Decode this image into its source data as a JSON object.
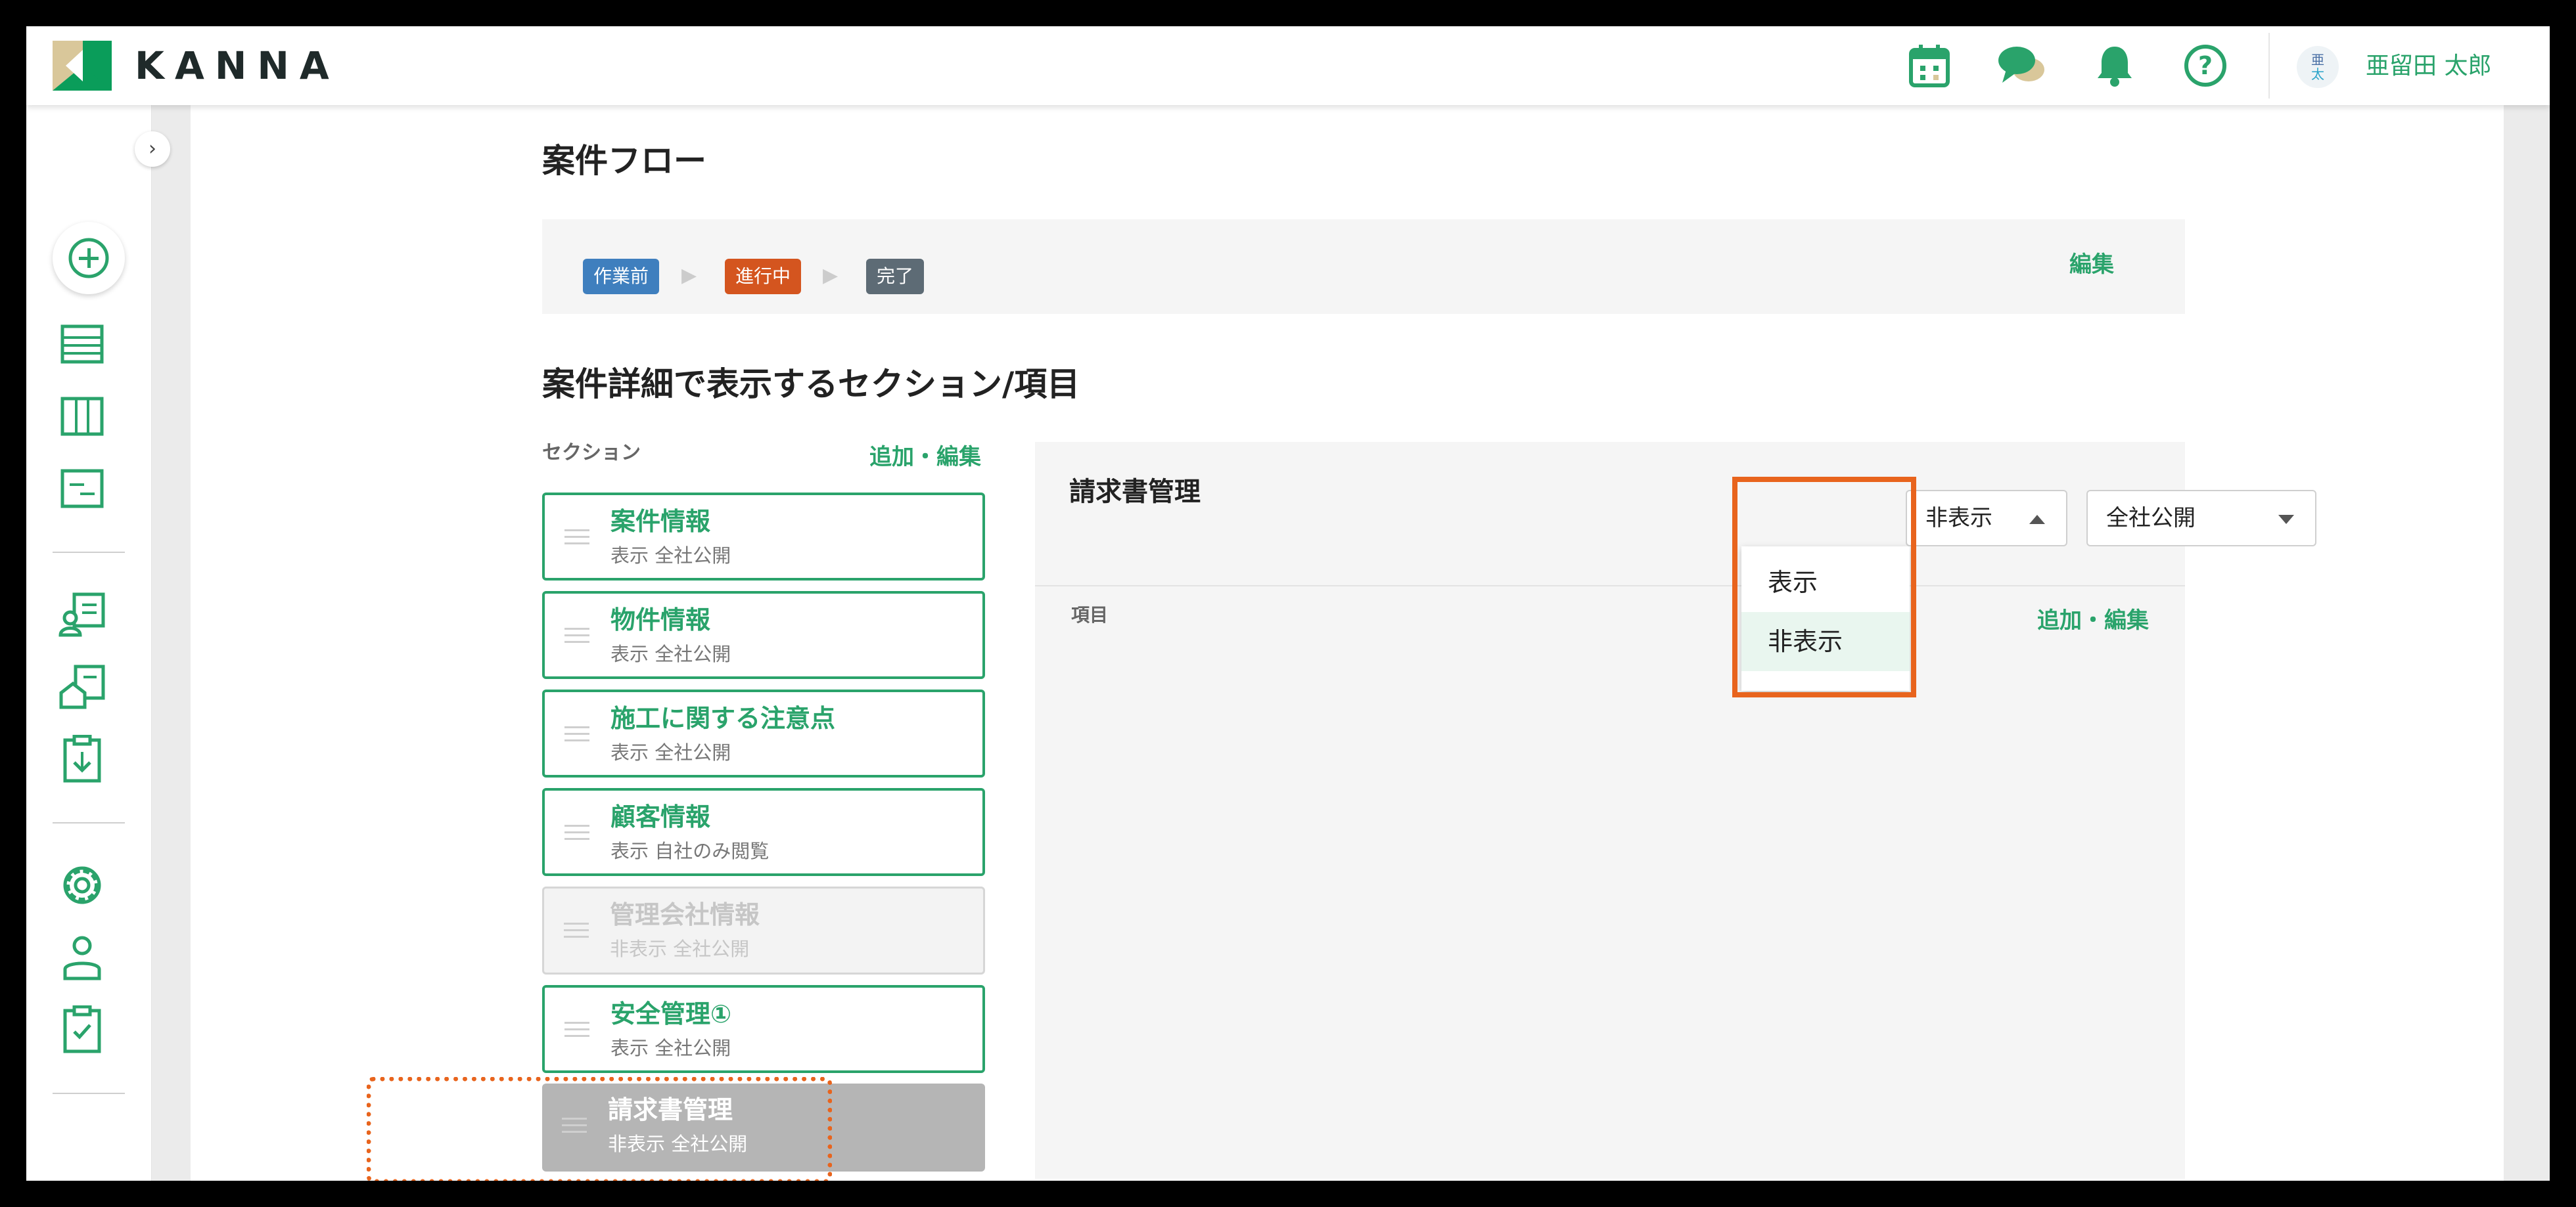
{
  "header": {
    "logo_text": "KANNA",
    "icons": [
      "calendar-icon",
      "chat-icon",
      "bell-icon",
      "help-icon"
    ],
    "avatar_line1": "亜",
    "avatar_line2": "太",
    "user_name": "亜留田 太郎"
  },
  "sidebar": {
    "toggle_glyph": "›",
    "icons": [
      "add-icon",
      "list-icon",
      "board-icon",
      "document-icon",
      "customer-icon",
      "property-icon",
      "download-clipboard-icon",
      "settings-icon",
      "user-icon",
      "clipboard-check-icon"
    ]
  },
  "flow": {
    "title": "案件フロー",
    "steps": [
      "作業前",
      "進行中",
      "完了"
    ],
    "arrow": "▶",
    "edit_label": "編集"
  },
  "detail": {
    "title": "案件詳細で表示するセクション/項目",
    "section_label": "セクション",
    "section_edit_label": "追加・編集",
    "sections": [
      {
        "title": "案件情報",
        "status": "表示 全社公開"
      },
      {
        "title": "物件情報",
        "status": "表示 全社公開"
      },
      {
        "title": "施工に関する注意点",
        "status": "表示 全社公開"
      },
      {
        "title": "顧客情報",
        "status": "表示 自社のみ閲覧"
      },
      {
        "title": "管理会社情報",
        "status": "非表示 全社公開"
      },
      {
        "title": "安全管理①",
        "status": "表示 全社公開"
      },
      {
        "title": "請求書管理",
        "status": "非表示 全社公開"
      }
    ]
  },
  "panel": {
    "title": "請求書管理",
    "visibility_select": "非表示",
    "scope_select": "全社公開",
    "dropdown_options": [
      "表示",
      "非表示"
    ],
    "item_label": "項目",
    "item_edit_label": "追加・編集"
  },
  "colors": {
    "accent": "#2aa36b",
    "highlight": "#e8641d",
    "chip_before": "#3f7fbe",
    "chip_progress": "#d4551f",
    "chip_done": "#5d6b75"
  }
}
